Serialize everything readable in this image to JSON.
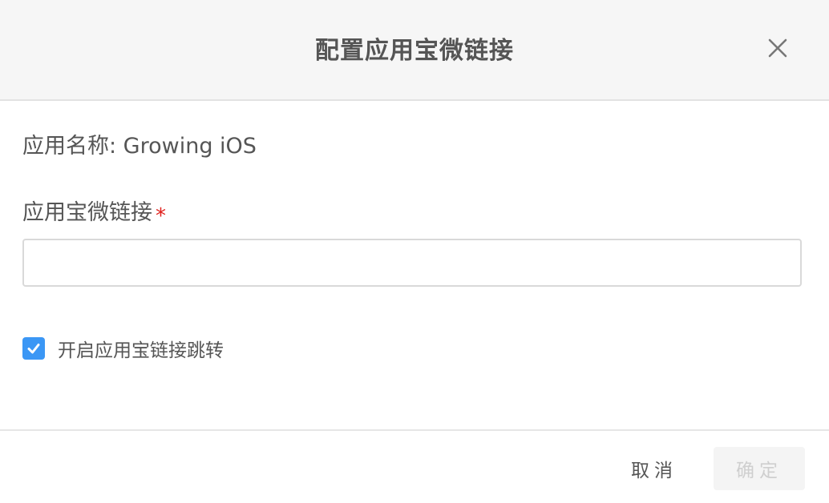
{
  "dialog": {
    "title": "配置应用宝微链接",
    "close_icon": "close-icon"
  },
  "form": {
    "app_name_text": "应用名称: Growing iOS",
    "link_label": "应用宝微链接",
    "required_mark": "*",
    "link_input": {
      "value": "",
      "placeholder": ""
    },
    "enable_jump": {
      "label": "开启应用宝链接跳转",
      "checked": true
    }
  },
  "footer": {
    "cancel_label": "取消",
    "confirm_label": "确定",
    "confirm_disabled": true
  },
  "colors": {
    "accent": "#3b97f5",
    "required": "#e0211d",
    "header_bg": "#f6f6f6",
    "disabled_text": "#cfcfcf"
  }
}
